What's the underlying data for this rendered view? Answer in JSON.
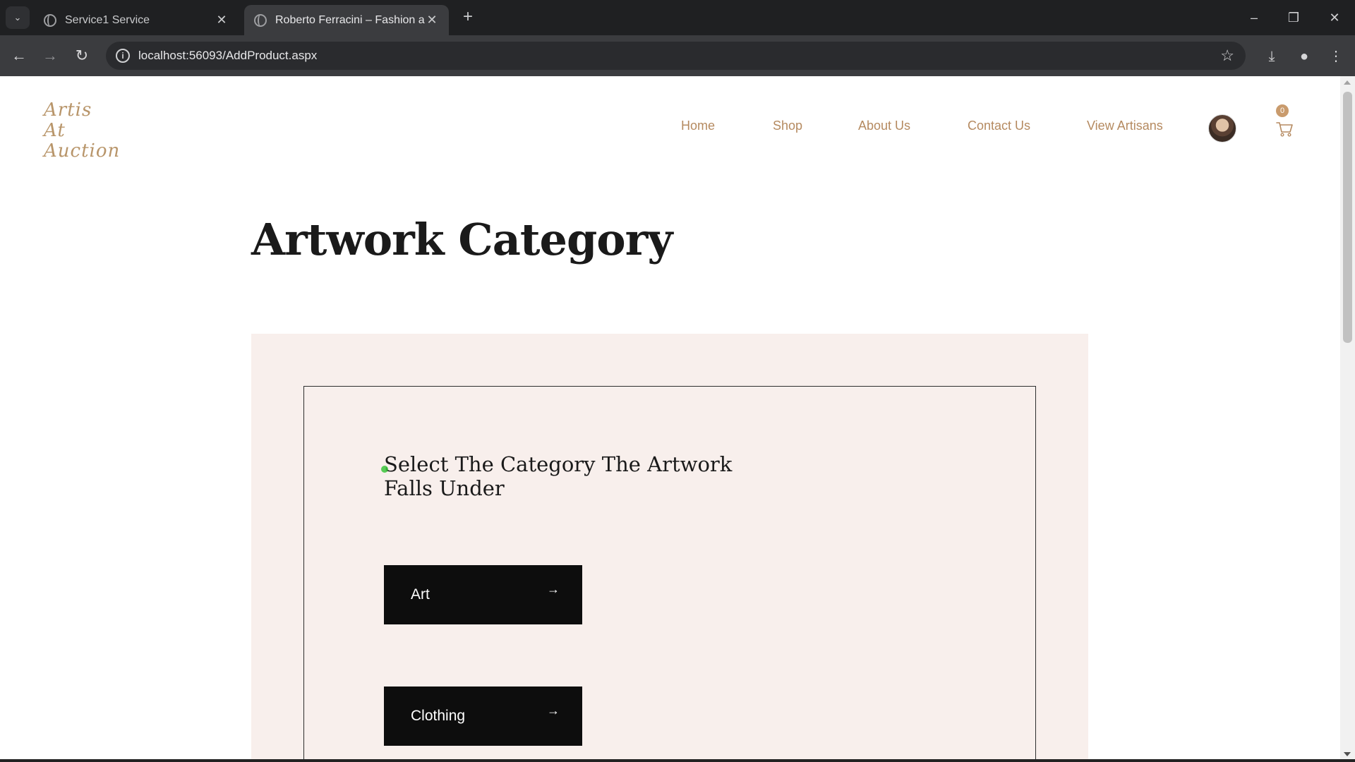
{
  "browser": {
    "tabs": [
      {
        "title": "Service1 Service",
        "active": false
      },
      {
        "title": "Roberto Ferracini – Fashion anc",
        "active": true
      }
    ],
    "url": "localhost:56093/AddProduct.aspx",
    "icons": [
      "tab-search-icon",
      "globe-icon",
      "close-icon",
      "plus-icon",
      "minimize-icon",
      "restore-icon",
      "back-icon",
      "forward-icon",
      "reload-icon",
      "info-icon",
      "star-icon",
      "download-icon",
      "profile-icon",
      "menu-icon"
    ]
  },
  "site": {
    "logo_lines": [
      "Artis",
      "At",
      "Auction"
    ],
    "nav": [
      "Home",
      "Shop",
      "About Us",
      "Contact Us",
      "View Artisans"
    ],
    "cart_count": "0",
    "accent_color": "#b58a60"
  },
  "main": {
    "title": "Artwork Category",
    "prompt": "Select The Category The Artwork Falls Under",
    "categories": [
      {
        "label": "Art",
        "arrow": "→"
      },
      {
        "label": "Clothing",
        "arrow": "→"
      }
    ]
  }
}
